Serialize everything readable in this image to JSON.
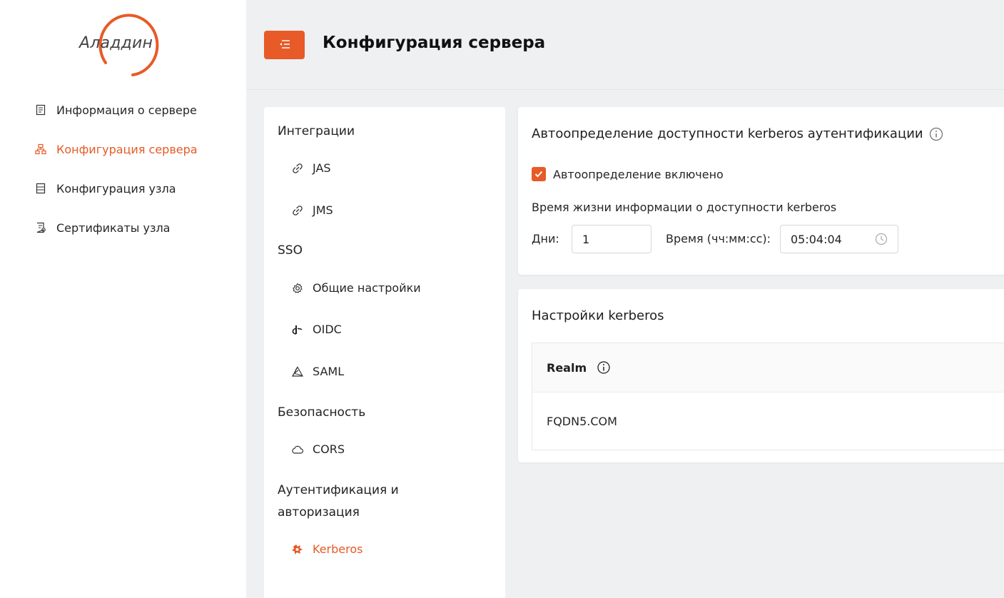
{
  "brand": {
    "logo_text": "Аладдин",
    "accent": "#e85a27"
  },
  "sidebar": {
    "items": [
      {
        "label": "Информация о сервере",
        "icon": "server-info-icon",
        "active": false
      },
      {
        "label": "Конфигурация сервера",
        "icon": "sitemap-icon",
        "active": true
      },
      {
        "label": "Конфигурация узла",
        "icon": "node-config-icon",
        "active": false
      },
      {
        "label": "Сертификаты узла",
        "icon": "certificate-icon",
        "active": false
      }
    ]
  },
  "header": {
    "title": "Конфигурация сервера",
    "menu_icon": "menu-collapse-icon"
  },
  "settings_menu": {
    "sections": [
      {
        "title": "Интеграции",
        "items": [
          {
            "label": "JAS",
            "icon": "link-icon"
          },
          {
            "label": "JMS",
            "icon": "link-icon"
          }
        ]
      },
      {
        "title": "SSO",
        "items": [
          {
            "label": "Общие настройки",
            "icon": "gear-icon"
          },
          {
            "label": "OIDC",
            "icon": "openid-icon"
          },
          {
            "label": "SAML",
            "icon": "saml-icon"
          }
        ]
      },
      {
        "title": "Безопасность",
        "items": [
          {
            "label": "CORS",
            "icon": "cloud-icon"
          }
        ]
      },
      {
        "title": "Аутентификация и авторизация",
        "items": [
          {
            "label": "Kerberos",
            "icon": "kerberos-icon",
            "active": true
          }
        ]
      }
    ]
  },
  "autodetect_card": {
    "title": "Автоопределение доступности kerberos аутентификации",
    "checkbox_label": "Автоопределение включено",
    "checkbox_checked": true,
    "lifetime_label": "Время жизни информации о доступности kerberos",
    "days_label": "Дни:",
    "days_value": "1",
    "time_label": "Время (чч:мм:сс):",
    "time_value": "05:04:04"
  },
  "kerberos_card": {
    "title": "Настройки kerberos",
    "table": {
      "columns": [
        "Realm"
      ],
      "rows": [
        [
          "FQDN5.COM"
        ]
      ]
    }
  }
}
